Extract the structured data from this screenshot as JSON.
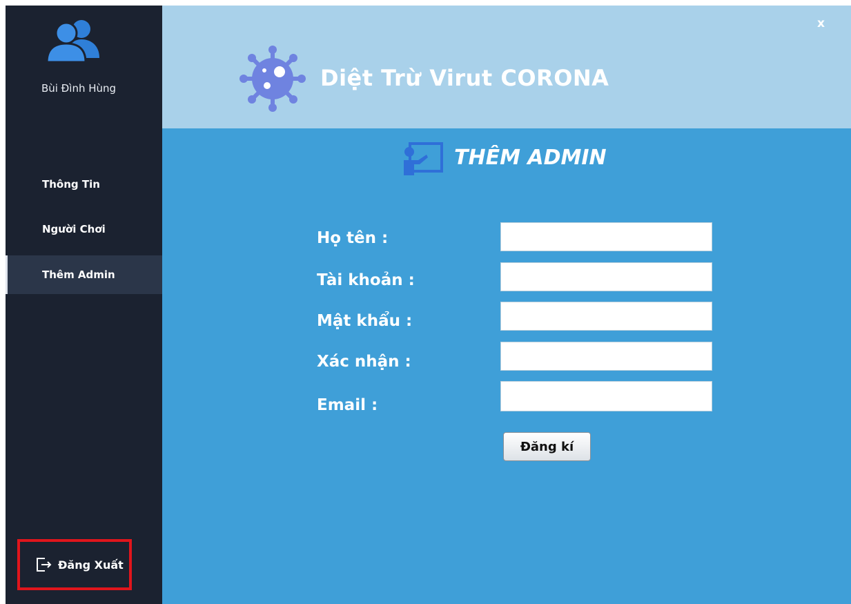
{
  "sidebar": {
    "username": "Bùi Đình Hùng",
    "avatar_icon": "users-icon",
    "items": [
      {
        "label": "Thông Tin"
      },
      {
        "label": "Người Chơi"
      },
      {
        "label": "Thêm Admin",
        "active": true
      }
    ],
    "logout_label": "Đăng Xuất",
    "logout_icon": "logout-icon"
  },
  "header": {
    "title": "Diệt Trừ Virut CORONA",
    "icon": "virus-icon",
    "close_label": "x"
  },
  "main": {
    "section_title": "THÊM ADMIN",
    "section_icon": "admin-board-icon",
    "fields": [
      {
        "label": "Họ tên :",
        "value": ""
      },
      {
        "label": "Tài khoản :",
        "value": ""
      },
      {
        "label": "Mật khẩu :",
        "value": ""
      },
      {
        "label": "Xác nhận :",
        "value": ""
      },
      {
        "label": "Email :",
        "value": ""
      }
    ],
    "submit_label": "Đăng kí"
  },
  "colors": {
    "sidebar_bg": "#1b2230",
    "sidebar_active": "#2b3649",
    "header_bg": "#a9d1ea",
    "main_bg": "#3f9fd8",
    "logout_border": "#e0151c",
    "icon_accent": "#6f83e0"
  }
}
